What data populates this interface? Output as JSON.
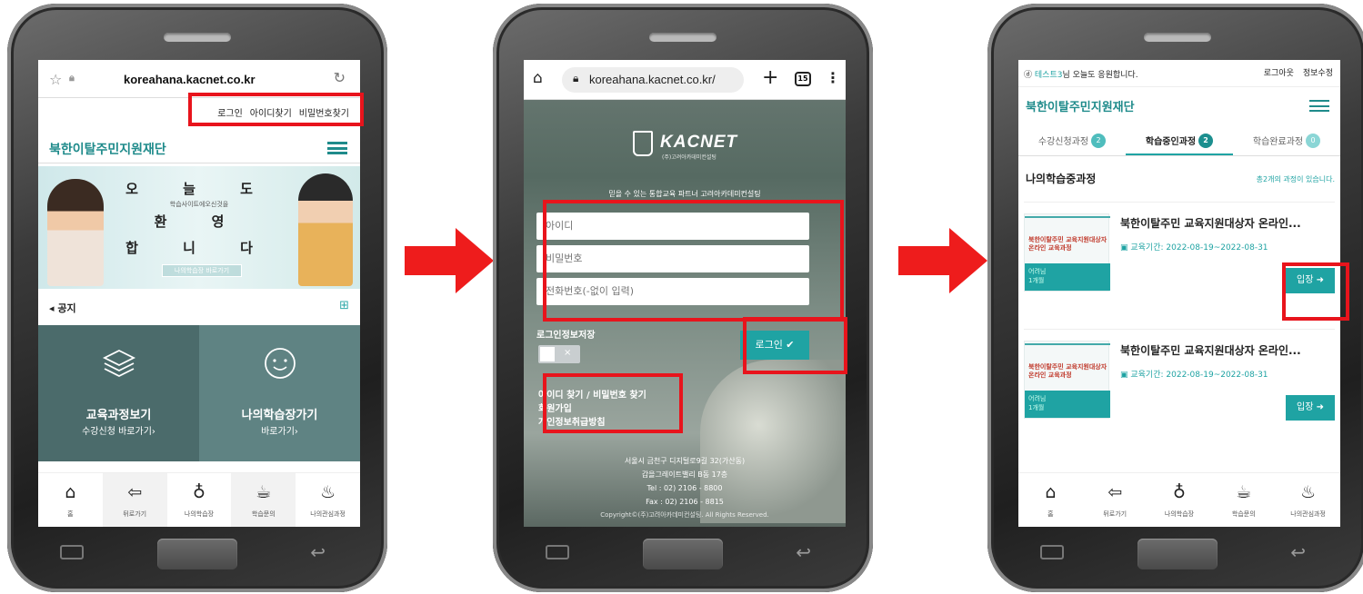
{
  "screen1": {
    "url": "koreahana.kacnet.co.kr",
    "top_links": [
      "로그인",
      "아이디찾기",
      "비밀번호찾기"
    ],
    "org_name": "북한이탈주민지원재단",
    "banner": {
      "line1": "오 늘 도",
      "line1_sub": "학습사이트에오신것을",
      "line2": "환 영",
      "line3": "합 니 다",
      "cta": "나의학습장 바로가기"
    },
    "notice_title": "◂ 공지",
    "tiles": [
      {
        "title": "교육과정보기",
        "sub": "수강신청 바로가기›",
        "icon": "layers-icon"
      },
      {
        "title": "나의학습장가기",
        "sub": "바로가기›",
        "icon": "smiley-icon"
      }
    ],
    "nav": [
      {
        "label": "홈",
        "glyph": "⌂"
      },
      {
        "label": "뒤로가기",
        "glyph": "⇦"
      },
      {
        "label": "나의학습장",
        "glyph": "♁"
      },
      {
        "label": "학습문의",
        "glyph": "☕"
      },
      {
        "label": "나의관심과정",
        "glyph": "♨"
      }
    ]
  },
  "screen2": {
    "url": "koreahana.kacnet.co.kr/",
    "tab_count": "15",
    "brand": "KACNET",
    "brand_sub": "(주)고려아카데미컨설팅",
    "tagline": "믿을 수 있는 통합교육 파트너 고려아카데미컨설팅",
    "placeholders": {
      "id": "아이디",
      "pw": "비밀번호",
      "phone": "전화번호(-없이 입력)"
    },
    "save_label": "로그인정보저장",
    "toggle_x": "×",
    "login_button": "로그인 ✔",
    "links": [
      "아이디 찾기 / 비밀번호 찾기",
      "회원가입",
      "개인정보취급방침"
    ],
    "footer": [
      "서울시 금천구 디지털로9길 32(가산동)",
      "갑을그레이트밸리 B동 17층",
      "Tel : 02) 2106 - 8800",
      "Fax : 02) 2106 - 8815"
    ],
    "copyright": "Copyright©(주)고려아카데미컨설팅. All Rights Reserved."
  },
  "screen3": {
    "greeting_user": "테스트3",
    "greeting_rest": "님 오늘도 응원합니다.",
    "logout": "로그아웃",
    "edit_profile": "정보수정",
    "org_name": "북한이탈주민지원재단",
    "tabs": [
      {
        "label": "수강신청과정",
        "badge": "2"
      },
      {
        "label": "학습중인과정",
        "badge": "2"
      },
      {
        "label": "학습완료과정",
        "badge": "0"
      }
    ],
    "section_title": "나의학습중과정",
    "section_count": "총2개의 과정이 있습니다.",
    "courses": [
      {
        "title": "북한이탈주민 교육지원대상자 온라인...",
        "period": "교육기간: 2022-08-19~2022-08-31",
        "thumb_text": "북한이탈주민 교육지원대상자 온라인 교육과정",
        "thumb_level": "어려님",
        "thumb_term": "1개월",
        "enter": "입장 ➜"
      },
      {
        "title": "북한이탈주민 교육지원대상자 온라인...",
        "period": "교육기간: 2022-08-19~2022-08-31",
        "thumb_text": "북한이탈주민 교육지원대상자 온라인 교육과정",
        "thumb_level": "어려님",
        "thumb_term": "1개월",
        "enter": "입장 ➜"
      }
    ],
    "nav": [
      {
        "label": "홈",
        "glyph": "⌂"
      },
      {
        "label": "뒤로가기",
        "glyph": "⇦"
      },
      {
        "label": "나의학습장",
        "glyph": "♁"
      },
      {
        "label": "학습문의",
        "glyph": "☕"
      },
      {
        "label": "나의관심과정",
        "glyph": "♨"
      }
    ]
  },
  "colors": {
    "accent": "#1fa3a3",
    "highlight_red": "#e8141c",
    "arrow_red": "#ee1c1c"
  }
}
